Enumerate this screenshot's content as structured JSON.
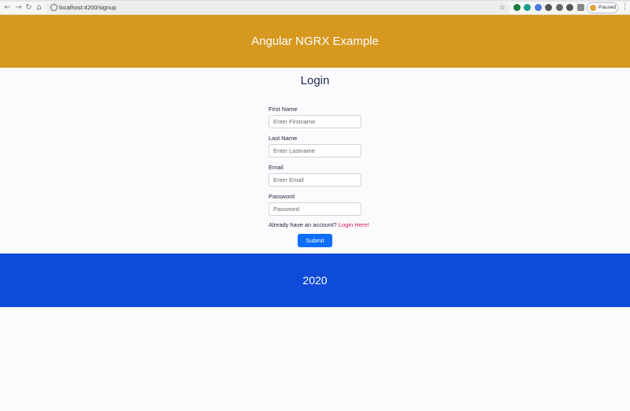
{
  "browser": {
    "url": "localhost:4200/signup",
    "profile_status": "Paused",
    "nav_icons": [
      "back-icon",
      "forward-icon",
      "reload-icon",
      "home-icon"
    ],
    "extension_colors": [
      "#1b7f3b",
      "#16a085",
      "#4c78e0",
      "#555555",
      "#666666",
      "#555555",
      "#888888"
    ]
  },
  "header": {
    "title": "Angular NGRX Example",
    "bg_color": "#d6981f"
  },
  "form": {
    "title": "Login",
    "fields": [
      {
        "label": "First Name",
        "placeholder": "Enter Firstname"
      },
      {
        "label": "Last Name",
        "placeholder": "Enter Lastname"
      },
      {
        "label": "Email",
        "placeholder": "Enter Email"
      },
      {
        "label": "Password",
        "placeholder": "Password"
      }
    ],
    "account_prompt": "Already have an account?",
    "login_link": "Login Here!",
    "submit_label": "Submit",
    "submit_color": "#0d6efd",
    "link_color": "#d81b60"
  },
  "footer": {
    "year": "2020",
    "bg_color": "#0f4bd9"
  }
}
